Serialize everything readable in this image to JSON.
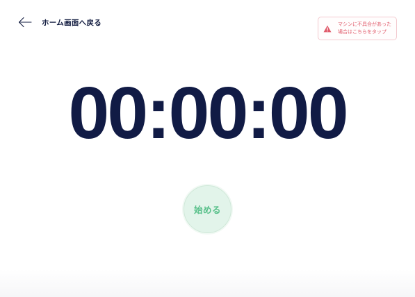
{
  "header": {
    "back_label": "ホーム画面へ戻る",
    "back_icon": "arrow-left-icon"
  },
  "report": {
    "line1": "マシンに不具合があった",
    "line2": "場合はこちらをタップ",
    "icon": "warning-icon",
    "color": "#e05a6a"
  },
  "timer": {
    "display": "00:00:00",
    "color": "#111b45"
  },
  "controls": {
    "start_label": "始める",
    "accent": "#58c08a"
  }
}
